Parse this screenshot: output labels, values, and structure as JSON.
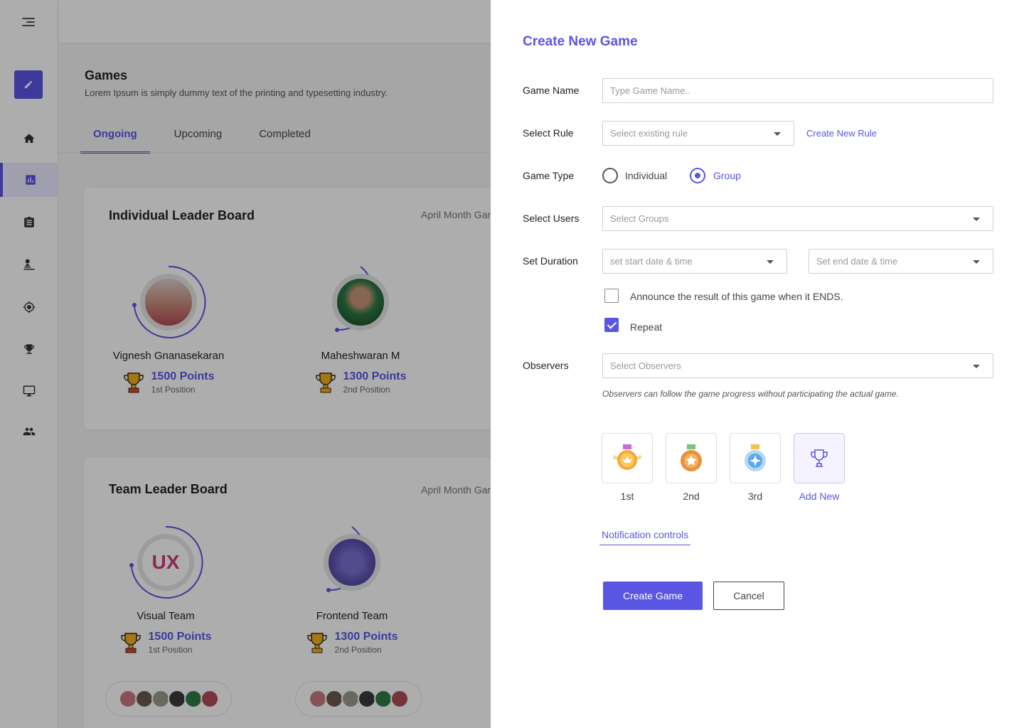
{
  "page": {
    "title": "Games",
    "subtitle": "Lorem Ipsum is simply dummy text of the printing and typesetting industry.",
    "tabs": [
      {
        "label": "Ongoing",
        "active": true
      },
      {
        "label": "Upcoming",
        "active": false
      },
      {
        "label": "Completed",
        "active": false
      }
    ]
  },
  "sidebar": {
    "items": [
      {
        "icon": "home-icon"
      },
      {
        "icon": "chart-icon",
        "active": true
      },
      {
        "icon": "clipboard-icon"
      },
      {
        "icon": "user-desk-icon"
      },
      {
        "icon": "target-icon"
      },
      {
        "icon": "trophy-icon"
      },
      {
        "icon": "monitor-icon"
      },
      {
        "icon": "group-icon"
      }
    ]
  },
  "individual_board": {
    "title": "Individual Leader Board",
    "meta": "April Month Gam",
    "players": [
      {
        "name": "Vignesh Gnanasekaran",
        "points": "1500 Points",
        "position": "1st Position"
      },
      {
        "name": "Maheshwaran M",
        "points": "1300 Points",
        "position": "2nd Position"
      }
    ]
  },
  "team_board": {
    "title": "Team Leader Board",
    "meta": "April Month Gam",
    "teams": [
      {
        "name": "Visual Team",
        "logo_text": "UX",
        "points": "1500 Points",
        "position": "1st Position"
      },
      {
        "name": "Frontend Team",
        "points": "1300 Points",
        "position": "2nd Position"
      }
    ]
  },
  "modal": {
    "title": "Create New Game",
    "game_name": {
      "label": "Game Name",
      "placeholder": "Type Game Name.."
    },
    "rule": {
      "label": "Select Rule",
      "placeholder": "Select existing rule",
      "create_link": "Create New Rule"
    },
    "game_type": {
      "label": "Game Type",
      "options": [
        "Individual",
        "Group"
      ],
      "selected": "Group"
    },
    "users": {
      "label": "Select Users",
      "placeholder": "Select Groups"
    },
    "duration": {
      "label": "Set Duration",
      "start_placeholder": "set start date & time",
      "end_placeholder": "Set end date & time"
    },
    "announce": {
      "label": "Announce the result of this game when it ENDS.",
      "checked": false
    },
    "repeat": {
      "label": "Repeat",
      "checked": true
    },
    "observers": {
      "label": "Observers",
      "placeholder": "Select Observers",
      "hint": "Observers can follow the game progress without participating the actual game."
    },
    "prizes": [
      {
        "label": "1st",
        "icon": "gold-medal-icon"
      },
      {
        "label": "2nd",
        "icon": "bronze-medal-icon"
      },
      {
        "label": "3rd",
        "icon": "silver-medal-icon"
      },
      {
        "label": "Add New",
        "icon": "trophy-outline-icon"
      }
    ],
    "notification_link": "Notification controls",
    "create_button": "Create Game",
    "cancel_button": "Cancel"
  },
  "colors": {
    "accent": "#5b55e3",
    "overlay": "rgba(0,0,0,0.32)"
  }
}
